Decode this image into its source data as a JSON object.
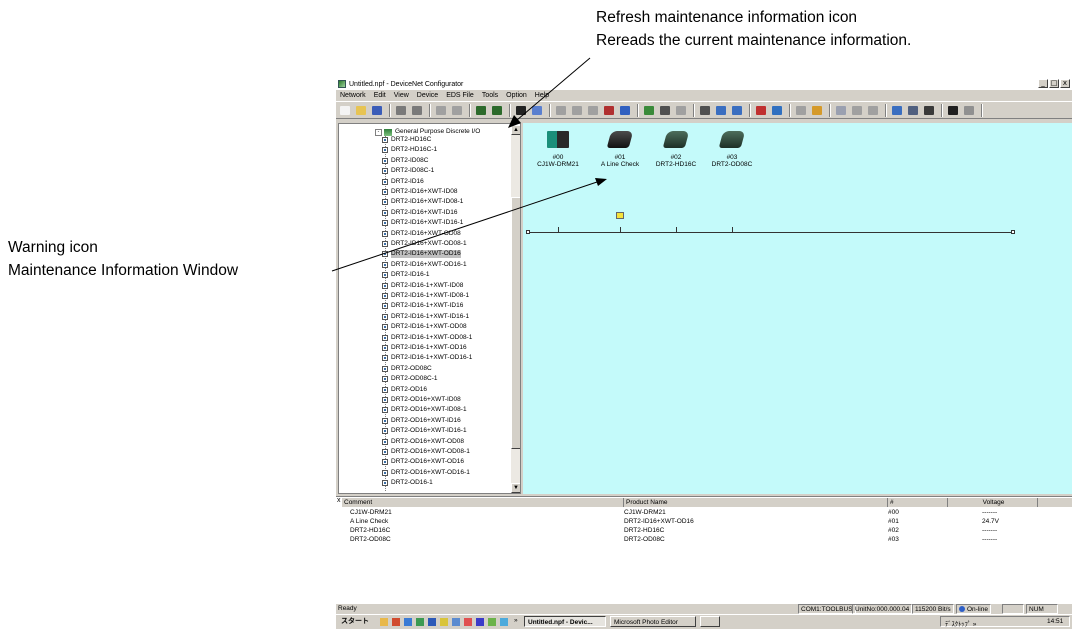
{
  "callouts": {
    "refresh_title": "Refresh maintenance information icon",
    "refresh_desc": "Rereads the current maintenance information.",
    "warning_title": "Warning icon",
    "warning_desc": "Maintenance Information Window"
  },
  "window": {
    "title": "Untitled.npf - DeviceNet Configurator",
    "min_glyph": "_",
    "max_glyph": "□",
    "close_glyph": "x"
  },
  "menu": [
    "Network",
    "Edit",
    "View",
    "Device",
    "EDS File",
    "Tools",
    "Option",
    "Help"
  ],
  "toolbar_icons": [
    "new-file-icon",
    "open-folder-icon",
    "save-icon",
    "print-preview-icon",
    "print-icon",
    "cut-icon",
    "copy-icon",
    "connect-icon",
    "disconnect-icon",
    "refresh-maintenance-icon",
    "upload-icon",
    "undo-icon",
    "copy-device-icon",
    "paste-icon",
    "delete-icon",
    "parameter-icon",
    "monitor-icon",
    "table-icon",
    "scan-icon",
    "grid-icon",
    "sort-icon",
    "sort2-icon",
    "add-icon",
    "remove-icon",
    "list-icon",
    "register-icon",
    "register2-icon",
    "eds-icon",
    "eds2-icon",
    "about-icon",
    "check-icon",
    "help-icon",
    "find-icon",
    "context-help-icon"
  ],
  "tree": {
    "root_label": "General Purpose Discrete I/O",
    "expander": "-",
    "close_glyph": "x",
    "selected_index": 11,
    "items": [
      "DRT2-HD16C",
      "DRT2-HD16C-1",
      "DRT2-ID08C",
      "DRT2-ID08C-1",
      "DRT2-ID16",
      "DRT2-ID16+XWT-ID08",
      "DRT2-ID16+XWT-ID08-1",
      "DRT2-ID16+XWT-ID16",
      "DRT2-ID16+XWT-ID16-1",
      "DRT2-ID16+XWT-OD08",
      "DRT2-ID16+XWT-OD08-1",
      "DRT2-ID16+XWT-OD16",
      "DRT2-ID16+XWT-OD16-1",
      "DRT2-ID16-1",
      "DRT2-ID16-1+XWT-ID08",
      "DRT2-ID16-1+XWT-ID08-1",
      "DRT2-ID16-1+XWT-ID16",
      "DRT2-ID16-1+XWT-ID16-1",
      "DRT2-ID16-1+XWT-OD08",
      "DRT2-ID16-1+XWT-OD08-1",
      "DRT2-ID16-1+XWT-OD16",
      "DRT2-ID16-1+XWT-OD16-1",
      "DRT2-OD08C",
      "DRT2-OD08C-1",
      "DRT2-OD16",
      "DRT2-OD16+XWT-ID08",
      "DRT2-OD16+XWT-ID08-1",
      "DRT2-OD16+XWT-ID16",
      "DRT2-OD16+XWT-ID16-1",
      "DRT2-OD16+XWT-OD08",
      "DRT2-OD16+XWT-OD08-1",
      "DRT2-OD16+XWT-OD16",
      "DRT2-OD16+XWT-OD16-1",
      "DRT2-OD16-1"
    ],
    "scroll_up": "▲",
    "scroll_down": "▼"
  },
  "network": {
    "devices": [
      {
        "address": "#00",
        "name": "CJ1W-DRM21",
        "icon": "master-unit-icon"
      },
      {
        "address": "#01",
        "name": "A Line Check",
        "icon": "slave-unit-icon",
        "warning": true
      },
      {
        "address": "#02",
        "name": "DRT2-HD16C",
        "icon": "slave-unit-icon"
      },
      {
        "address": "#03",
        "name": "DRT2-OD08C",
        "icon": "slave-unit-icon"
      }
    ]
  },
  "maintenance": {
    "close_glyph": "x",
    "columns": [
      "Comment",
      "Product Name",
      "#",
      "Voltage"
    ],
    "rows": [
      {
        "comment": "CJ1W-DRM21",
        "product": "CJ1W-DRM21",
        "num": "#00",
        "voltage": "-------"
      },
      {
        "comment": "A Line Check",
        "product": "DRT2-ID16+XWT-OD16",
        "num": "#01",
        "voltage": "24.7V"
      },
      {
        "comment": "DRT2-HD16C",
        "product": "DRT2-HD16C",
        "num": "#02",
        "voltage": "-------"
      },
      {
        "comment": "DRT2-OD08C",
        "product": "DRT2-OD08C",
        "num": "#03",
        "voltage": "-------"
      }
    ]
  },
  "status": {
    "left": "Ready",
    "port": "COM1:TOOLBUS",
    "unit": "UnitNo:000.000.04",
    "baud": "115200 Bit/s",
    "mode": "On-line",
    "blank": "",
    "num": "NUM"
  },
  "taskbar": {
    "start": "スタート",
    "more": "»",
    "tasks": [
      {
        "label": "Untitled.npf - Devic...",
        "active": true
      },
      {
        "label": "Microsoft Photo Editor",
        "active": false
      },
      {
        "label": "",
        "active": false
      }
    ],
    "tray_label": "ﾃﾞｽｸﾄｯﾌﾟ »",
    "clock": "14:51"
  }
}
